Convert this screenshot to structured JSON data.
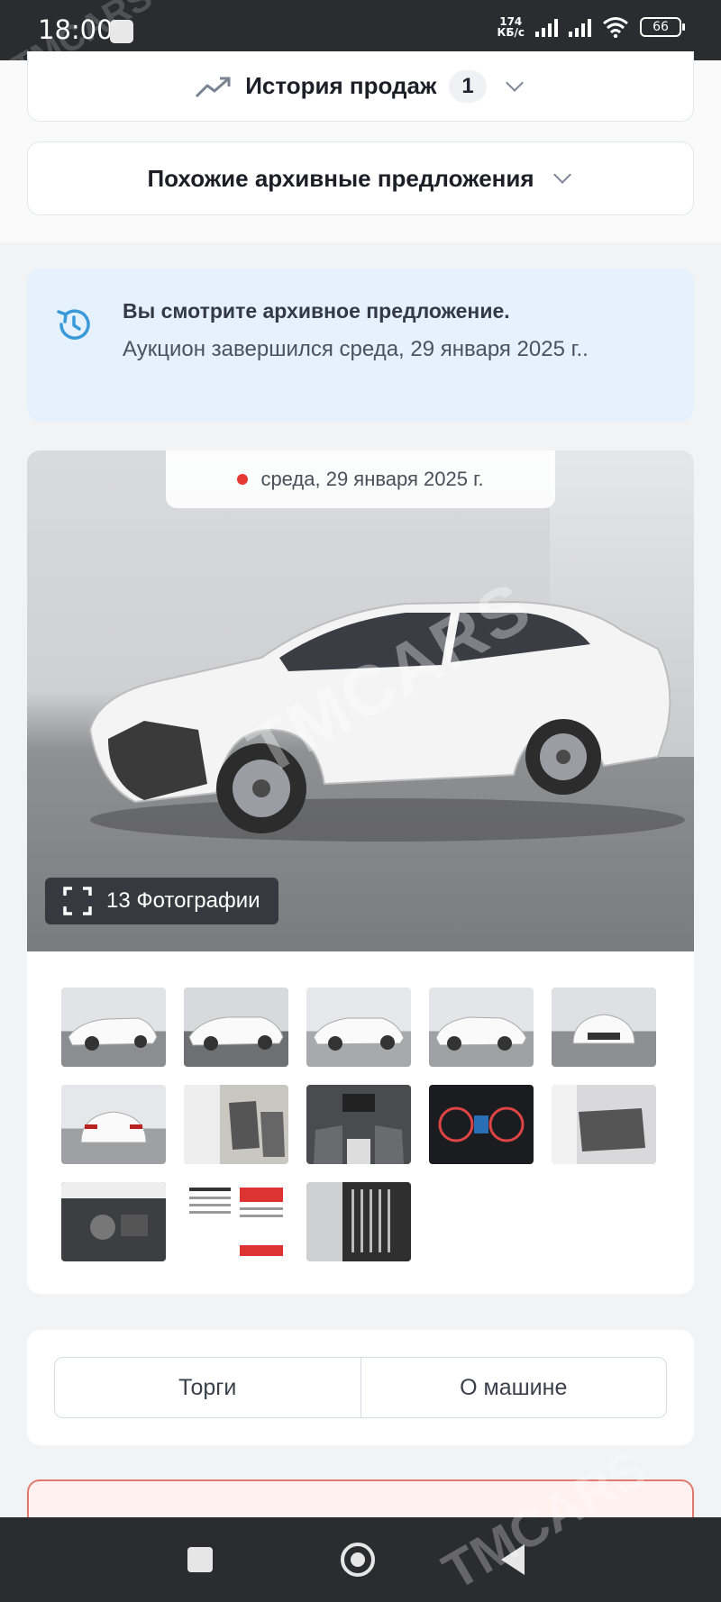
{
  "status_bar": {
    "time": "18:00",
    "speed_value": "174",
    "speed_unit": "КБ/с",
    "battery": "66"
  },
  "watermark": "TMCARS",
  "sales_history": {
    "label": "История продаж",
    "count": "1"
  },
  "similar_archive": {
    "label": "Похожие архивные предложения"
  },
  "archive_notice": {
    "title": "Вы смотрите архивное предложение.",
    "text": "Аукцион завершился среда, 29 января 2025 г.."
  },
  "gallery": {
    "date": "среда, 29 января 2025 г.",
    "photo_count_label": "13 Фотографии",
    "thumbnails": [
      "front-left-damaged",
      "side-left",
      "rear-left",
      "front-right-damaged",
      "front",
      "rear",
      "interior-front-seat",
      "dashboard",
      "instrument-cluster",
      "rear-seats",
      "engine-bay",
      "document-sheet",
      "vin-label"
    ]
  },
  "tabs": [
    {
      "label": "Торги"
    },
    {
      "label": "О машине"
    }
  ],
  "colors": {
    "accent_blue": "#3a9ad9",
    "info_bg": "#e5f1fd",
    "status_bar": "#2b2c30",
    "alert_red": "#e53935"
  }
}
